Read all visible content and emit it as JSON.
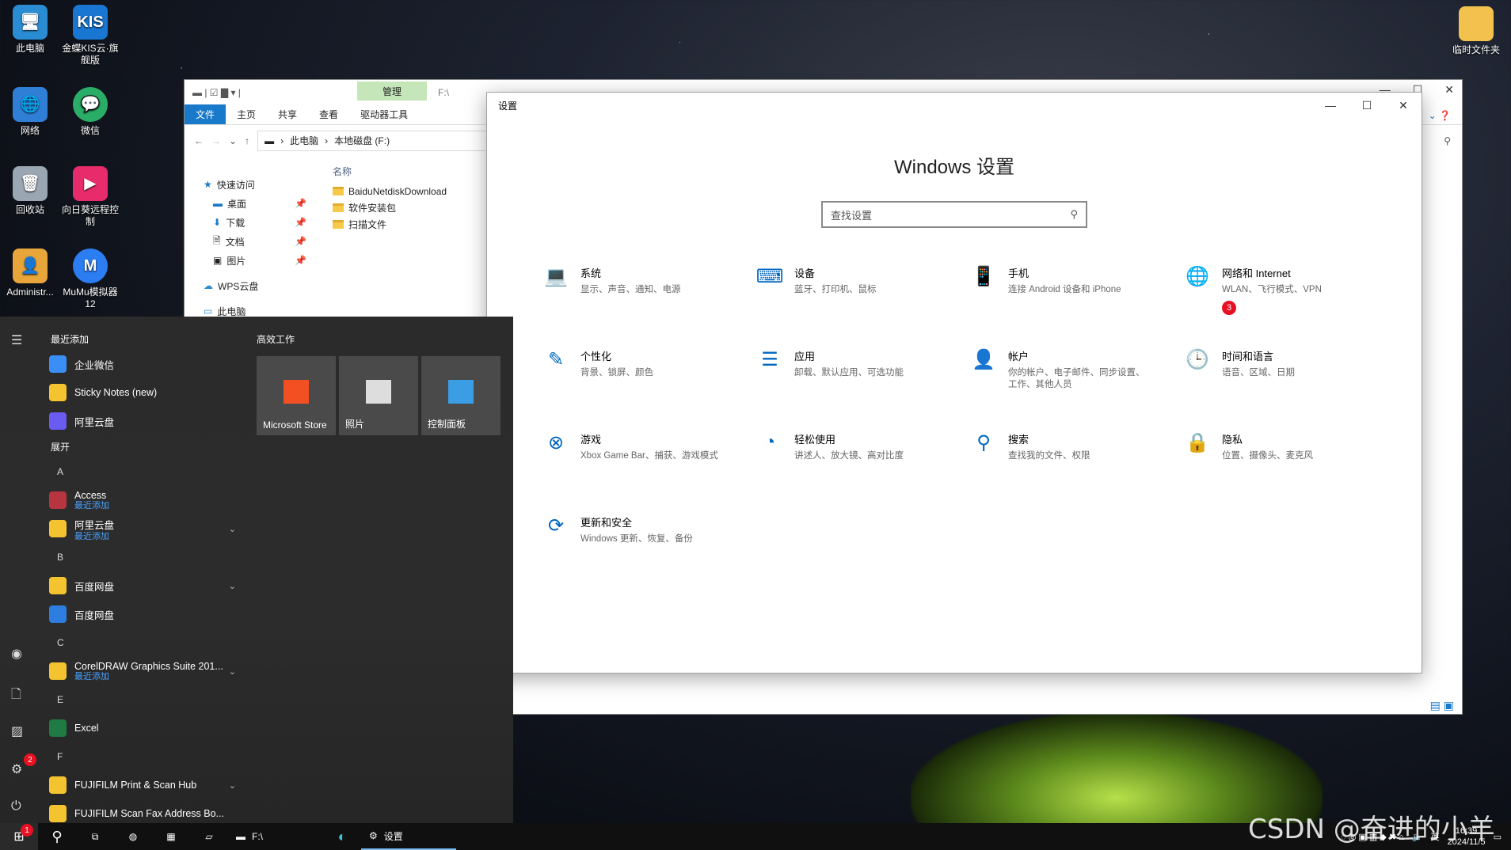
{
  "desktop": {
    "icons": [
      {
        "label": "此电脑",
        "color": "#2a8dd4"
      },
      {
        "label": "金蝶KIS云·旗舰版",
        "color": "#1976d2",
        "glyph": "KIS"
      },
      {
        "label": "临时文件夹",
        "color": "#f2c14e"
      },
      {
        "label": "网络",
        "color": "#2f7fd6"
      },
      {
        "label": "微信",
        "color": "#2aae67"
      },
      {
        "label": "回收站",
        "color": "#9aa7b3"
      },
      {
        "label": "向日葵远程控制",
        "color": "#e82b6a"
      },
      {
        "label": "Administr...",
        "color": "#e8a53a"
      },
      {
        "label": "MuMu模拟器12",
        "color": "#2c7df2"
      }
    ]
  },
  "explorer": {
    "manage_tab": "管理",
    "path_title": "F:\\",
    "ribbon_tabs": [
      "文件",
      "主页",
      "共享",
      "查看",
      "驱动器工具"
    ],
    "breadcrumb": [
      "此电脑",
      "本地磁盘 (F:)"
    ],
    "nav_items": [
      "快速访问",
      "桌面",
      "下载",
      "文档",
      "图片",
      "WPS云盘",
      "此电脑"
    ],
    "column_header": "名称",
    "files": [
      "BaiduNetdiskDownload",
      "软件安装包",
      "扫描文件"
    ]
  },
  "settings": {
    "window_title": "设置",
    "heading": "Windows 设置",
    "search_placeholder": "查找设置",
    "tiles": [
      {
        "title": "系统",
        "desc": "显示、声音、通知、电源",
        "icon": "laptop-icon",
        "glyph": "💻"
      },
      {
        "title": "设备",
        "desc": "蓝牙、打印机、鼠标",
        "icon": "devices-icon",
        "glyph": "⌨"
      },
      {
        "title": "手机",
        "desc": "连接 Android 设备和 iPhone",
        "icon": "phone-icon",
        "glyph": "📱"
      },
      {
        "title": "网络和 Internet",
        "desc": "WLAN、飞行模式、VPN",
        "icon": "globe-icon",
        "glyph": "🌐",
        "badge": "3"
      },
      {
        "title": "个性化",
        "desc": "背景、锁屏、颜色",
        "icon": "personalize-icon",
        "glyph": "✎"
      },
      {
        "title": "应用",
        "desc": "卸载、默认应用、可选功能",
        "icon": "apps-icon",
        "glyph": "☰"
      },
      {
        "title": "帐户",
        "desc": "你的帐户、电子邮件、同步设置、工作、其他人员",
        "icon": "person-icon",
        "glyph": "👤"
      },
      {
        "title": "时间和语言",
        "desc": "语音、区域、日期",
        "icon": "time-language-icon",
        "glyph": "🕒"
      },
      {
        "title": "游戏",
        "desc": "Xbox Game Bar、捕获、游戏模式",
        "icon": "xbox-icon",
        "glyph": "⊗"
      },
      {
        "title": "轻松使用",
        "desc": "讲述人、放大镜、高对比度",
        "icon": "ease-of-access-icon",
        "glyph": "◔"
      },
      {
        "title": "搜索",
        "desc": "查找我的文件、权限",
        "icon": "search-icon",
        "glyph": "⚲"
      },
      {
        "title": "隐私",
        "desc": "位置、摄像头、麦克风",
        "icon": "lock-icon",
        "glyph": "🔒"
      },
      {
        "title": "更新和安全",
        "desc": "Windows 更新、恢复、备份",
        "icon": "update-icon",
        "glyph": "⟳"
      }
    ]
  },
  "start_menu": {
    "recent_header": "最近添加",
    "recent": [
      {
        "label": "企业微信",
        "color": "#3a8ef6"
      },
      {
        "label": "Sticky Notes (new)",
        "color": "#f3c330"
      },
      {
        "label": "阿里云盘",
        "color": "#6a5cf0"
      }
    ],
    "expand_label": "展开",
    "sections": [
      {
        "letter": "A",
        "items": [
          {
            "label": "Access",
            "sub": "最近添加",
            "color": "#b7353f"
          },
          {
            "label": "阿里云盘",
            "sub": "最近添加",
            "color": "#f3c330",
            "chevron": true
          }
        ]
      },
      {
        "letter": "B",
        "items": [
          {
            "label": "百度网盘",
            "sub": "",
            "color": "#f3c330",
            "chevron": true
          },
          {
            "label": "百度网盘",
            "sub": "",
            "color": "#2e7de1"
          }
        ]
      },
      {
        "letter": "C",
        "items": [
          {
            "label": "CorelDRAW Graphics Suite 201...",
            "sub": "最近添加",
            "color": "#f3c330",
            "chevron": true
          }
        ]
      },
      {
        "letter": "E",
        "items": [
          {
            "label": "Excel",
            "sub": "",
            "color": "#1f7a44"
          }
        ]
      },
      {
        "letter": "F",
        "items": [
          {
            "label": "FUJIFILM Print & Scan Hub",
            "sub": "",
            "color": "#f3c330",
            "chevron": true
          },
          {
            "label": "FUJIFILM Scan Fax Address Bo...",
            "sub": "",
            "color": "#f3c330"
          }
        ]
      }
    ],
    "tiles_header": "高效工作",
    "tiles": [
      {
        "label": "Microsoft Store",
        "color": "#f25022"
      },
      {
        "label": "照片",
        "color": "#ddd"
      },
      {
        "label": "控制面板",
        "color": "#3b9de4"
      }
    ],
    "settings_badge": "2"
  },
  "taskbar": {
    "start_badge": "1",
    "explorer_label": "F:\\",
    "settings_label": "设置",
    "ime": "英",
    "time": "16:39",
    "date": "2024/11/5"
  },
  "watermark": "CSDN @奋进的小羊"
}
